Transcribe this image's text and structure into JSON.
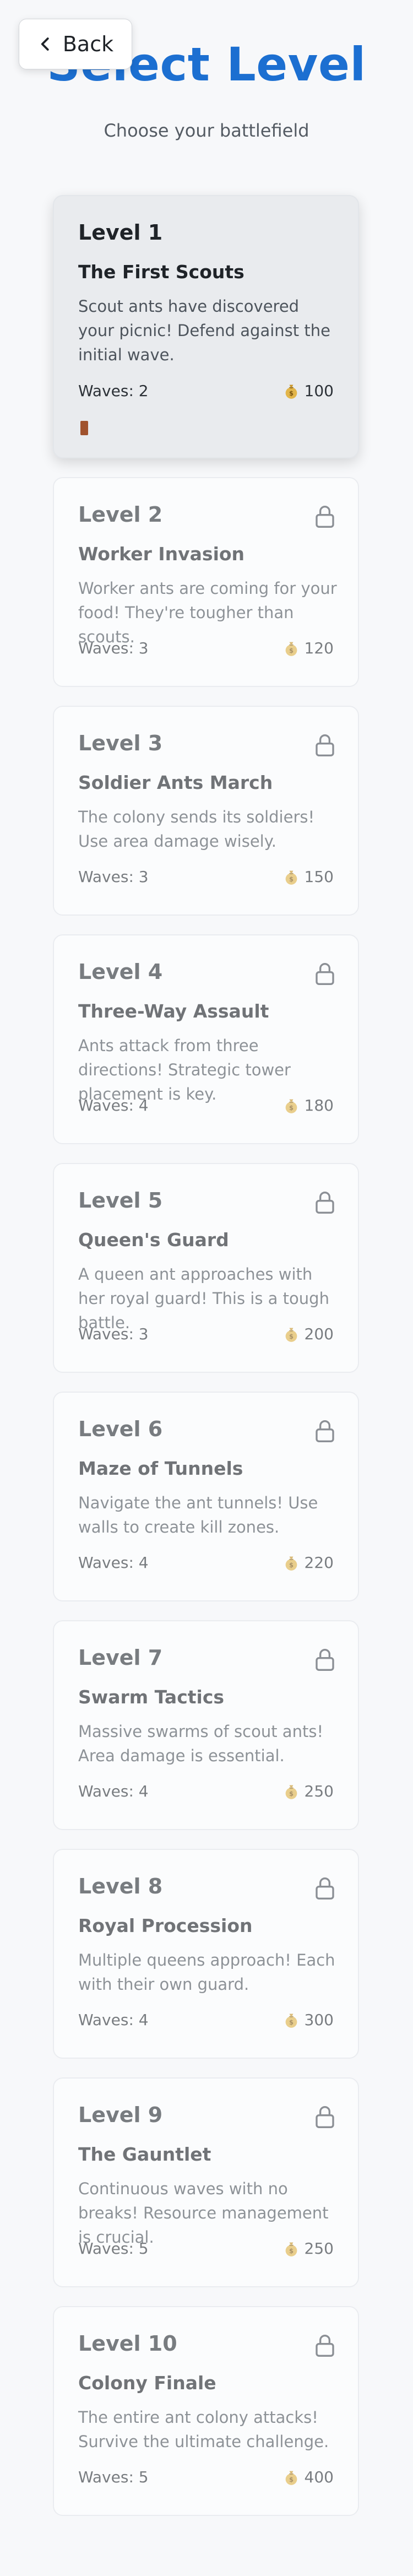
{
  "header": {
    "back_label": "Back",
    "title": "Select Level",
    "subtitle": "Choose your battlefield"
  },
  "levels": [
    {
      "number": "Level 1",
      "name": "The First Scouts",
      "description": "Scout ants have discovered your picnic! Defend against the initial wave.",
      "waves": "Waves: 2",
      "reward": "100",
      "locked": false
    },
    {
      "number": "Level 2",
      "name": "Worker Invasion",
      "description": "Worker ants are coming for your food! They're tougher than scouts.",
      "waves": "Waves: 3",
      "reward": "120",
      "locked": true
    },
    {
      "number": "Level 3",
      "name": "Soldier Ants March",
      "description": "The colony sends its soldiers! Use area damage wisely.",
      "waves": "Waves: 3",
      "reward": "150",
      "locked": true
    },
    {
      "number": "Level 4",
      "name": "Three-Way Assault",
      "description": "Ants attack from three directions! Strategic tower placement is key.",
      "waves": "Waves: 4",
      "reward": "180",
      "locked": true
    },
    {
      "number": "Level 5",
      "name": "Queen's Guard",
      "description": "A queen ant approaches with her royal guard! This is a tough battle.",
      "waves": "Waves: 3",
      "reward": "200",
      "locked": true
    },
    {
      "number": "Level 6",
      "name": "Maze of Tunnels",
      "description": "Navigate the ant tunnels! Use walls to create kill zones.",
      "waves": "Waves: 4",
      "reward": "220",
      "locked": true
    },
    {
      "number": "Level 7",
      "name": "Swarm Tactics",
      "description": "Massive swarms of scout ants! Area damage is essential.",
      "waves": "Waves: 4",
      "reward": "250",
      "locked": true
    },
    {
      "number": "Level 8",
      "name": "Royal Procession",
      "description": "Multiple queens approach! Each with their own guard.",
      "waves": "Waves: 4",
      "reward": "300",
      "locked": true
    },
    {
      "number": "Level 9",
      "name": "The Gauntlet",
      "description": "Continuous waves with no breaks! Resource management is crucial.",
      "waves": "Waves: 5",
      "reward": "250",
      "locked": true
    },
    {
      "number": "Level 10",
      "name": "Colony Finale",
      "description": "The entire ant colony attacks! Survive the ultimate challenge.",
      "waves": "Waves: 5",
      "reward": "400",
      "locked": true
    }
  ],
  "colors": {
    "title": "#1c6fd1",
    "unlocked_card": "#e9ebee",
    "locked_card": "#ffffff",
    "progress_marker": "#a0522d"
  },
  "icons": {
    "back": "chevron-left-icon",
    "lock": "lock-icon",
    "reward": "money-bag-icon"
  }
}
